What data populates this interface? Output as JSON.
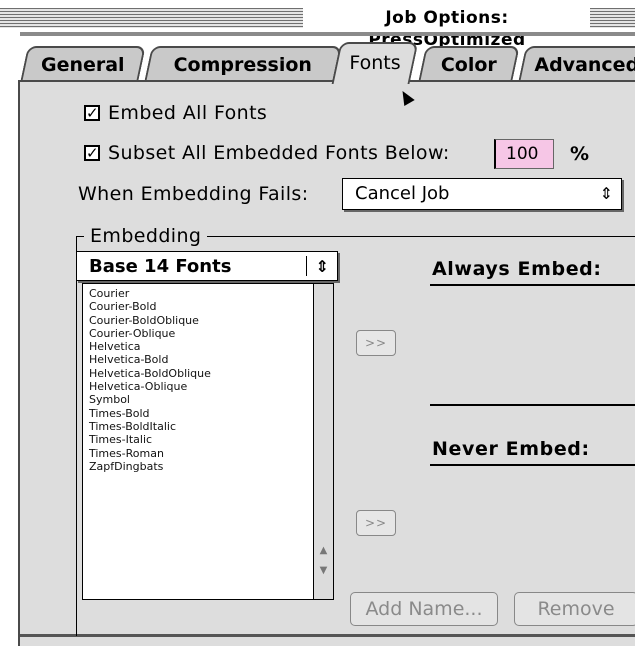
{
  "window": {
    "title": "Job Options: PressOptimized"
  },
  "tabs": [
    {
      "label": "General",
      "active": false
    },
    {
      "label": "Compression",
      "active": false
    },
    {
      "label": "Fonts",
      "active": true
    },
    {
      "label": "Color",
      "active": false
    },
    {
      "label": "Advanced",
      "active": false
    }
  ],
  "options": {
    "embed_all": {
      "label": "Embed All Fonts",
      "checked": true,
      "mark": "✓"
    },
    "subset_all": {
      "label": "Subset All Embedded Fonts Below:",
      "checked": true,
      "mark": "✓"
    },
    "subset_value": "100",
    "subset_unit": "%",
    "fail_label": "When Embedding Fails:",
    "fail_value": "Cancel Job"
  },
  "embedding": {
    "group_title": "Embedding",
    "font_source": "Base 14 Fonts",
    "fonts": [
      "Courier",
      "Courier-Bold",
      "Courier-BoldOblique",
      "Courier-Oblique",
      "Helvetica",
      "Helvetica-Bold",
      "Helvetica-BoldOblique",
      "Helvetica-Oblique",
      "Symbol",
      "Times-Bold",
      "Times-BoldItalic",
      "Times-Italic",
      "Times-Roman",
      "ZapfDingbats"
    ],
    "move_always_label": ">>",
    "move_never_label": ">>",
    "always_heading": "Always Embed:",
    "never_heading": "Never Embed:",
    "add_name_label": "Add Name...",
    "remove_label": "Remove"
  },
  "icons": {
    "popup_arrows": "updown-arrows-icon",
    "scroll_up": "scroll-up-icon",
    "scroll_down": "scroll-down-icon",
    "cursor": "mouse-pointer-icon"
  }
}
